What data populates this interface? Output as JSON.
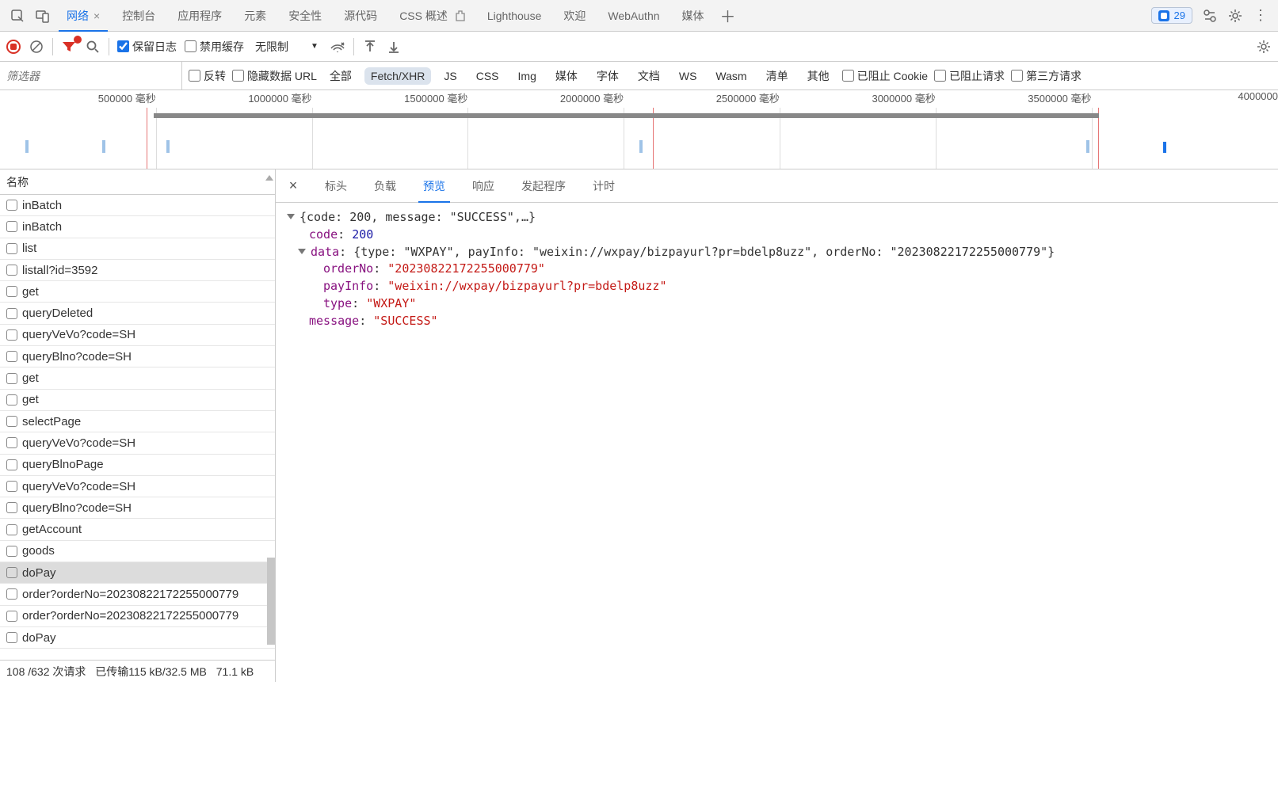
{
  "tabs": {
    "network": "网络",
    "console": "控制台",
    "application": "应用程序",
    "elements": "元素",
    "security": "安全性",
    "sources": "源代码",
    "css_overview": "CSS 概述",
    "lighthouse": "Lighthouse",
    "welcome": "欢迎",
    "webauthn": "WebAuthn",
    "media": "媒体"
  },
  "issues_count": "29",
  "toolbar": {
    "preserve_log": "保留日志",
    "disable_cache": "禁用缓存",
    "throttle": "无限制"
  },
  "filter": {
    "placeholder": "筛选器",
    "invert": "反转",
    "hide_data_urls": "隐藏数据 URL",
    "chips": {
      "all": "全部",
      "fetch_xhr": "Fetch/XHR",
      "js": "JS",
      "css": "CSS",
      "img": "Img",
      "media": "媒体",
      "font": "字体",
      "doc": "文档",
      "ws": "WS",
      "wasm": "Wasm",
      "manifest": "清单",
      "other": "其他"
    },
    "blocked_cookies": "已阻止 Cookie",
    "blocked_requests": "已阻止请求",
    "third_party": "第三方请求"
  },
  "timeline": {
    "ticks": [
      "500000 毫秒",
      "1000000 毫秒",
      "1500000 毫秒",
      "2000000 毫秒",
      "2500000 毫秒",
      "3000000 毫秒",
      "3500000 毫秒",
      "4000000"
    ]
  },
  "req_header": "名称",
  "requests": [
    "inBatch",
    "inBatch",
    "list",
    "listall?id=3592",
    "get",
    "queryDeleted",
    "queryVeVo?code=SH",
    "queryBlno?code=SH",
    "get",
    "get",
    "selectPage",
    "queryVeVo?code=SH",
    "queryBlnoPage",
    "queryVeVo?code=SH",
    "queryBlno?code=SH",
    "getAccount",
    "goods",
    "doPay",
    "order?orderNo=20230822172255000779",
    "order?orderNo=20230822172255000779",
    "doPay"
  ],
  "selected_index": 17,
  "status": {
    "req_count": "108 /632 次请求",
    "transferred": "已传输115 kB/32.5 MB",
    "resources": "71.1 kB"
  },
  "detail_tabs": {
    "headers": "标头",
    "payload": "负载",
    "preview": "预览",
    "response": "响应",
    "initiator": "发起程序",
    "timing": "计时"
  },
  "preview": {
    "summary_prefix": "{code: 200, message: \"SUCCESS\",…}",
    "code_key": "code",
    "code_val": "200",
    "data_key": "data",
    "data_summary": "{type: \"WXPAY\", payInfo: \"weixin://wxpay/bizpayurl?pr=bdelp8uzz\", orderNo: \"20230822172255000779\"}",
    "orderNo_key": "orderNo",
    "orderNo_val": "\"20230822172255000779\"",
    "payInfo_key": "payInfo",
    "payInfo_val": "\"weixin://wxpay/bizpayurl?pr=bdelp8uzz\"",
    "type_key": "type",
    "type_val": "\"WXPAY\"",
    "message_key": "message",
    "message_val": "\"SUCCESS\""
  }
}
